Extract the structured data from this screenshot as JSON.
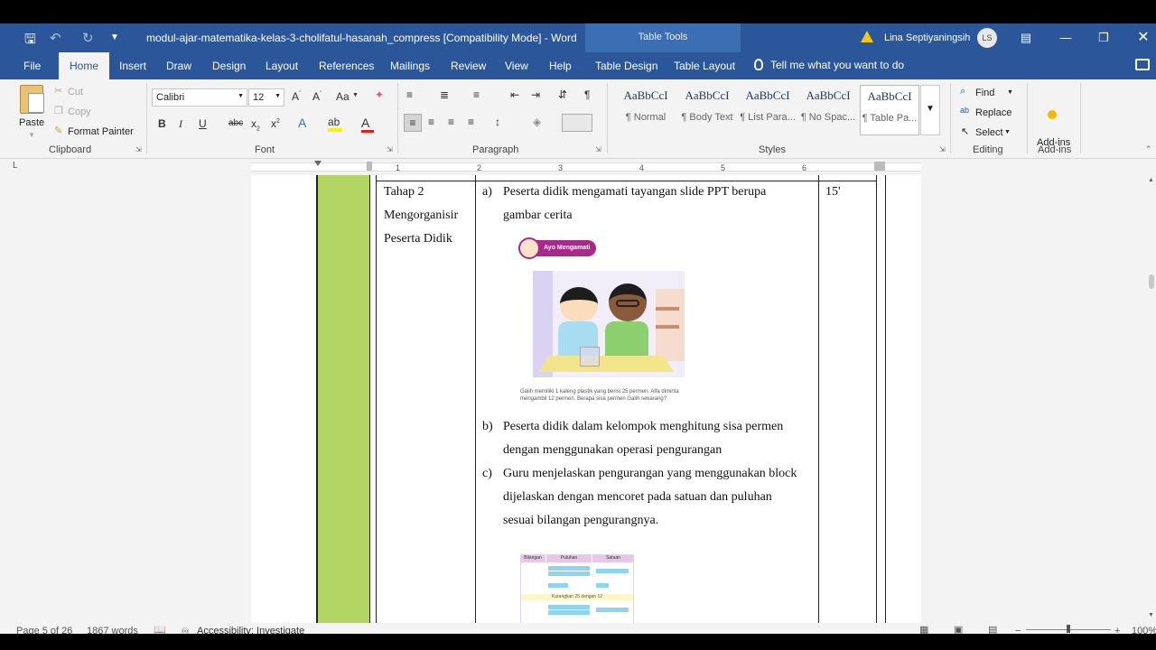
{
  "window": {
    "doc_title": "modul-ajar-matematika-kelas-3-cholifatul-hasanah_compress [Compatibility Mode]  -  Word",
    "contextual_title": "Table Tools",
    "user_name": "Lina Septiyaningsih",
    "user_initials": "LS"
  },
  "tabs": [
    "File",
    "Home",
    "Insert",
    "Draw",
    "Design",
    "Layout",
    "References",
    "Mailings",
    "Review",
    "View",
    "Help",
    "Table Design",
    "Table Layout"
  ],
  "tell_me": "Tell me what you want to do",
  "ribbon": {
    "clipboard": {
      "paste": "Paste",
      "cut": "Cut",
      "copy": "Copy",
      "format_painter": "Format Painter",
      "label": "Clipboard"
    },
    "font": {
      "name": "Calibri",
      "size": "12",
      "change_case": "Aa",
      "label": "Font"
    },
    "paragraph": {
      "label": "Paragraph"
    },
    "styles": {
      "preview": "AaBbCcI",
      "items": [
        "¶ Normal",
        "¶ Body Text",
        "¶ List Para...",
        "¶ No Spac...",
        "¶ Table Pa..."
      ],
      "label": "Styles"
    },
    "editing": {
      "find": "Find",
      "replace": "Replace",
      "select": "Select",
      "label": "Editing"
    },
    "addins": {
      "button": "Add-ins",
      "label": "Add-ins"
    }
  },
  "ruler_numbers": [
    "1",
    "2",
    "3",
    "4",
    "5",
    "6"
  ],
  "document": {
    "stage": [
      "Tahap 2",
      "Mengorganisir",
      "Peserta Didik"
    ],
    "duration": "15'",
    "item_a_marker": "a)",
    "item_a": [
      "Peserta didik mengamati tayangan slide PPT berupa",
      "gambar cerita"
    ],
    "item_b_marker": "b)",
    "item_b": [
      "Peserta didik dalam kelompok menghitung sisa permen",
      "dengan menggunakan operasi pengurangan"
    ],
    "item_c_marker": "c)",
    "item_c": [
      "Guru menjelaskan pengurangan yang menggunakan block",
      "dijelaskan dengan mencoret pada satuan dan puluhan",
      "sesuai bilangan pengurangnya."
    ],
    "image_badge": "Ayo Mengamati",
    "image_caption": "Galih memiliki 1 kaleng plastik yang berisi 25 permen. Alfa diminta mengambil 12 permen. Berapa sisa permen Galih sekarang?",
    "table_headers": [
      "Bilangan",
      "Puluhan",
      "Satuan"
    ],
    "table_row_label": "Kurangkan 25 dengan 12"
  },
  "status": {
    "page": "Page 5 of 26",
    "words": "1867 words",
    "accessibility": "Accessibility: Investigate",
    "zoom": "100%"
  }
}
